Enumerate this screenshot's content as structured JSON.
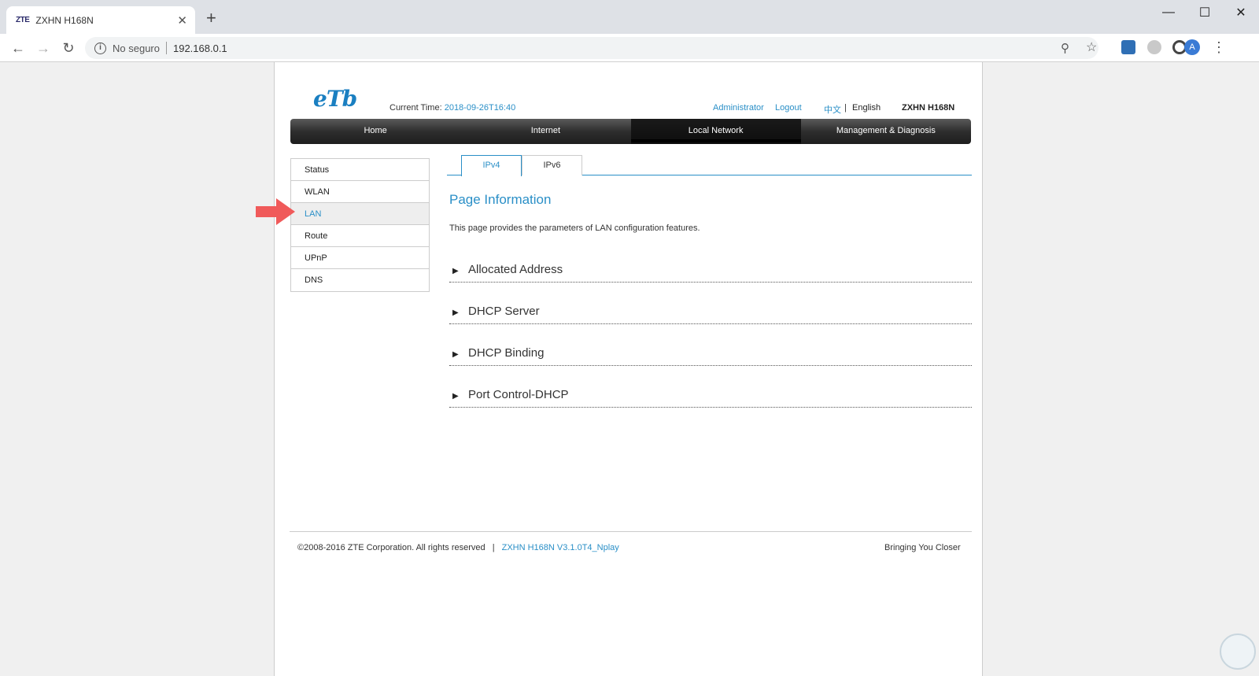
{
  "browser": {
    "tab": {
      "favicon": "ZTE",
      "title": "ZXHN H168N",
      "close": "✕"
    },
    "newtab": "+",
    "window_controls": {
      "minimize": "—",
      "maximize": "☐",
      "close": "✕"
    },
    "nav": {
      "back": "←",
      "forward": "→",
      "reload": "↻"
    },
    "omnibox": {
      "security": "No seguro",
      "url": "192.168.0.1"
    },
    "avatar_letter": "A",
    "icons": [
      "zoom-icon",
      "bookmark-star-icon",
      "cast-icon",
      "extension-icon",
      "sync-icon"
    ]
  },
  "header": {
    "logo": "eTb",
    "current_time_label": "Current Time:",
    "current_time_value": "2018-09-26T16:40",
    "user": "Administrator",
    "logout": "Logout",
    "lang_chinese": "中文",
    "lang_sep": "|",
    "lang_english": "English",
    "model": "ZXHN H168N"
  },
  "mainnav": [
    {
      "label": "Home",
      "active": false
    },
    {
      "label": "Internet",
      "active": false
    },
    {
      "label": "Local Network",
      "active": true
    },
    {
      "label": "Management & Diagnosis",
      "active": false
    }
  ],
  "sidemenu": [
    {
      "label": "Status",
      "active": false
    },
    {
      "label": "WLAN",
      "active": false
    },
    {
      "label": "LAN",
      "active": true
    },
    {
      "label": "Route",
      "active": false
    },
    {
      "label": "UPnP",
      "active": false
    },
    {
      "label": "DNS",
      "active": false
    }
  ],
  "subtabs": [
    {
      "label": "IPv4",
      "active": true
    },
    {
      "label": "IPv6",
      "active": false
    }
  ],
  "content": {
    "title": "Page Information",
    "description": "This page provides the parameters of LAN configuration features.",
    "sections": [
      "Allocated Address",
      "DHCP Server",
      "DHCP Binding",
      "Port Control-DHCP"
    ]
  },
  "footer": {
    "copyright": "©2008-2016 ZTE Corporation. All rights reserved",
    "sep": "|",
    "version": "ZXHN H168N V3.1.0T4_Nplay",
    "slogan": "Bringing You Closer"
  },
  "colors": {
    "link": "#2a8fc7",
    "arrow": "#f05a5a",
    "nav_dark": "#2e2e2e"
  }
}
